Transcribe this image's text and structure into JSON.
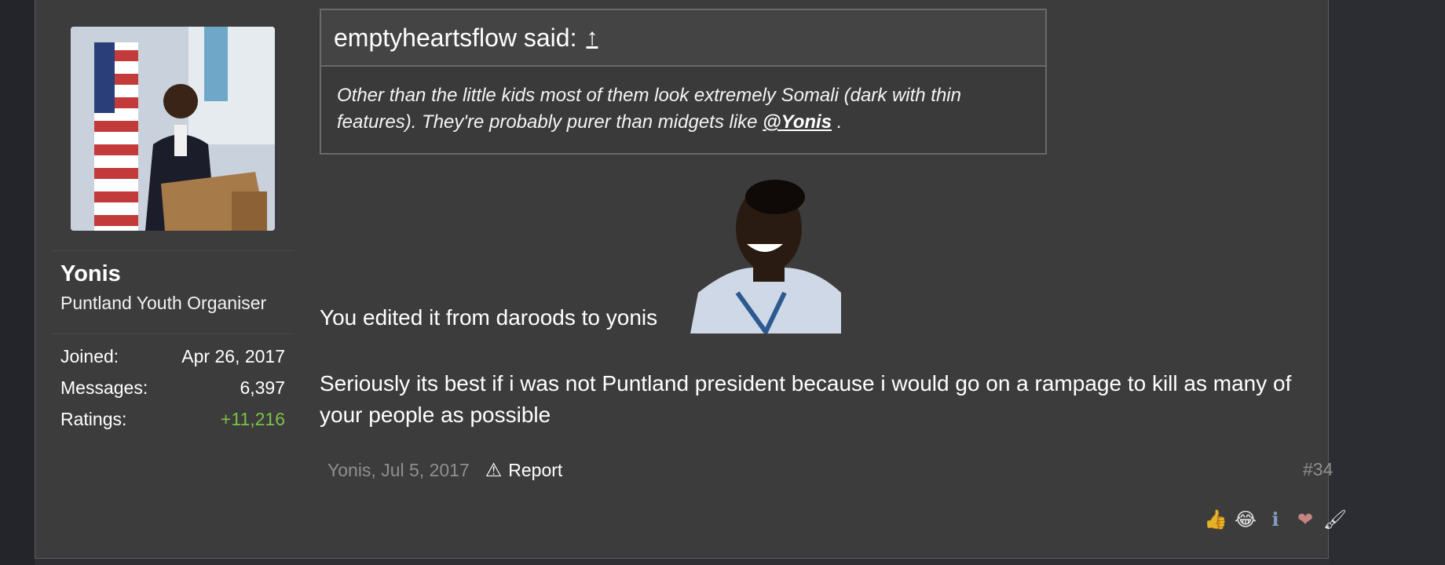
{
  "quote": {
    "author_label": "emptyheartsflow said:",
    "jump_arrow": "↑",
    "text_before": "Other than the little kids most of them look extremely Somali (dark with thin features). They're probably purer than midgets like ",
    "mention": "@Yonis",
    "text_after": " ."
  },
  "user": {
    "name": "Yonis",
    "title": "Puntland Youth Organiser",
    "stats": [
      {
        "label": "Joined:",
        "value": "Apr 26, 2017"
      },
      {
        "label": "Messages:",
        "value": "6,397"
      },
      {
        "label": "Ratings:",
        "value": "+11,216"
      }
    ]
  },
  "message": {
    "line1": "You edited it from daroods to yonis",
    "line2": "Seriously its best if i was not Puntland president because i would go on a rampage to kill as many of your people as possible"
  },
  "footer": {
    "author_date": "Yonis, Jul 5, 2017",
    "report_label": "Report",
    "post_number": "#34"
  },
  "reactions": [
    {
      "icon": "thumbs-up-icon",
      "glyph": "👍"
    },
    {
      "icon": "laugh-icon",
      "glyph": "😂"
    },
    {
      "icon": "info-icon",
      "glyph": "ℹ"
    },
    {
      "icon": "heart-icon",
      "glyph": "❤"
    },
    {
      "icon": "brush-icon",
      "glyph": "🖌"
    }
  ],
  "colors": {
    "background": "#23252b",
    "post_bg": "#3c3c3c",
    "positive": "#7cc04a",
    "muted": "#8f8f8f"
  }
}
